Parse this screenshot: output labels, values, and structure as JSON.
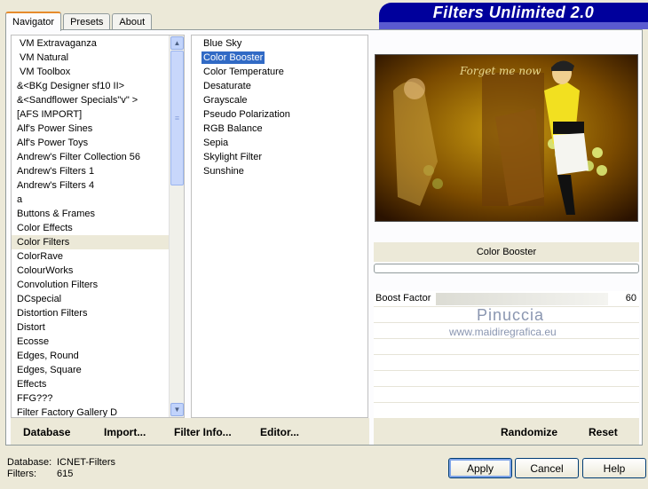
{
  "banner": {
    "title": "Filters Unlimited 2.0"
  },
  "tabs": [
    {
      "label": "Navigator"
    },
    {
      "label": "Presets"
    },
    {
      "label": "About"
    }
  ],
  "categories": [
    "VM Extravaganza",
    "VM Natural",
    "VM Toolbox",
    "&<BKg Designer sf10 II>",
    "&<Sandflower Specials\"v\" >",
    "[AFS IMPORT]",
    "Alf's Power Sines",
    "Alf's Power Toys",
    "Andrew's Filter Collection 56",
    "Andrew's Filters 1",
    "Andrew's Filters 4",
    "a",
    "Buttons & Frames",
    "Color Effects",
    "Color Filters",
    "ColorRave",
    "ColourWorks",
    "Convolution Filters",
    "DCspecial",
    "Distortion Filters",
    "Distort",
    "Ecosse",
    "Edges, Round",
    "Edges, Square",
    "Effects",
    "FFG???",
    "Filter Factory Gallery D"
  ],
  "filters": [
    "Blue Sky",
    "Color Booster",
    "Color Temperature",
    "Desaturate",
    "Grayscale",
    "Pseudo Polarization",
    "RGB Balance",
    "Sepia",
    "Skylight Filter",
    "Sunshine"
  ],
  "lowbar": {
    "database": "Database",
    "import": "Import...",
    "filter_info": "Filter Info...",
    "editor": "Editor..."
  },
  "preview": {
    "title": "Forget me now",
    "filter_name": "Color Booster"
  },
  "params": [
    {
      "label": "Boost Factor",
      "value": "60"
    }
  ],
  "watermark": {
    "name": "Pinuccia",
    "site": "www.maidiregrafica.eu"
  },
  "rightbar": {
    "randomize": "Randomize",
    "reset": "Reset"
  },
  "status": {
    "db_label": "Database:",
    "db_value": "ICNET-Filters",
    "filters_label": "Filters:",
    "filters_value": "615"
  },
  "buttons": {
    "apply": "Apply",
    "cancel": "Cancel",
    "help": "Help"
  }
}
